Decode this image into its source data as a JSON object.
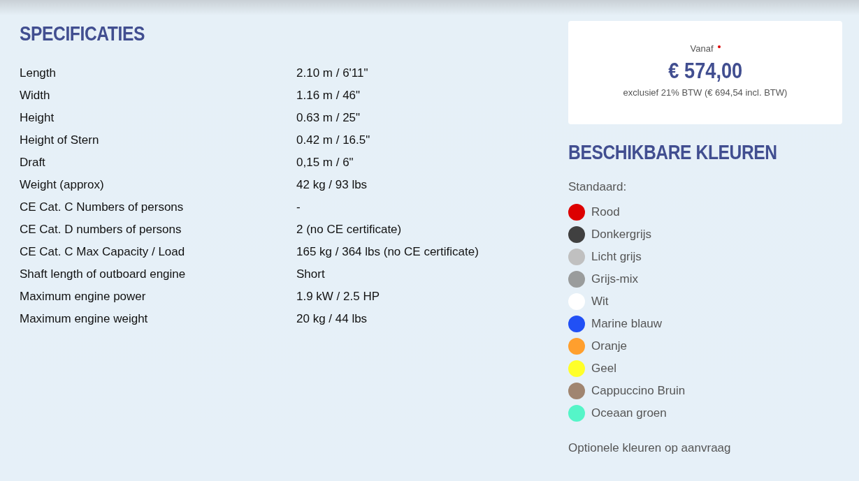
{
  "specs": {
    "title": "SPECIFICATIES",
    "rows": [
      {
        "label": "Length",
        "value": "2.10 m / 6'11\""
      },
      {
        "label": "Width",
        "value": "1.16 m / 46\""
      },
      {
        "label": "Height",
        "value": "0.63 m / 25\""
      },
      {
        "label": "Height of Stern",
        "value": "0.42 m / 16.5\""
      },
      {
        "label": "Draft",
        "value": "0,15 m / 6\""
      },
      {
        "label": "Weight (approx)",
        "value": "42 kg / 93 lbs"
      },
      {
        "label": "CE Cat. C Numbers of persons",
        "value": "-"
      },
      {
        "label": "CE Cat. D numbers of persons",
        "value": "2 (no CE certificate)"
      },
      {
        "label": "CE Cat. C Max Capacity / Load",
        "value": "165 kg / 364 lbs (no CE certificate)"
      },
      {
        "label": "Shaft length of outboard engine",
        "value": "Short"
      },
      {
        "label": "Maximum engine power",
        "value": "1.9 kW / 2.5 HP"
      },
      {
        "label": "Maximum engine weight",
        "value": "20 kg / 44 lbs"
      }
    ]
  },
  "price": {
    "label": "Vanaf",
    "price": "€ 574,00",
    "note": "exclusief 21% BTW (€ 694,54 incl. BTW)"
  },
  "colors": {
    "title": "BESCHIKBARE KLEUREN",
    "subtitle": "Standaard:",
    "items": [
      {
        "name": "Rood",
        "color": "#dd0000"
      },
      {
        "name": "Donkergrijs",
        "color": "#404040"
      },
      {
        "name": "Licht grijs",
        "color": "#c0c0c0"
      },
      {
        "name": "Grijs-mix",
        "color": "#9a9c9c"
      },
      {
        "name": "Wit",
        "color": "#ffffff"
      },
      {
        "name": "Marine blauw",
        "color": "#2150f5"
      },
      {
        "name": "Oranje",
        "color": "#ff9f2e"
      },
      {
        "name": "Geel",
        "color": "#ffff2a"
      },
      {
        "name": "Cappuccino Bruin",
        "color": "#a08570"
      },
      {
        "name": "Oceaan groen",
        "color": "#55f5c8"
      }
    ],
    "footnote": "Optionele kleuren op aanvraag"
  }
}
